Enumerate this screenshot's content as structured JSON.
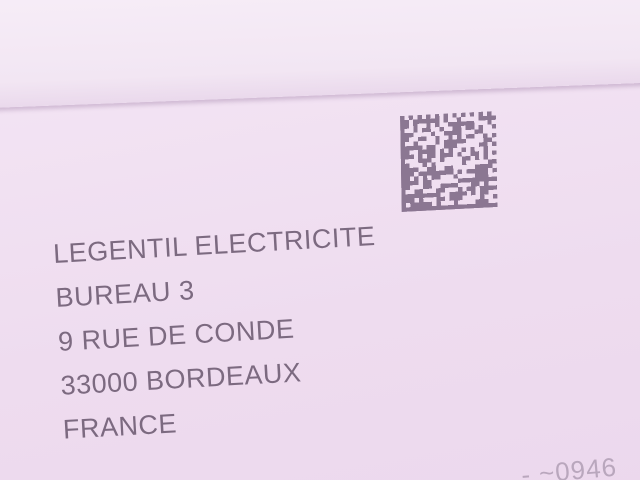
{
  "address": {
    "lines": [
      "LEGENTIL ELECTRICITE",
      "BUREAU 3",
      "9 RUE DE CONDE",
      "33000 BORDEAUX",
      "FRANCE"
    ]
  },
  "colors": {
    "paper": "#efe0f1",
    "ink": "#7c6a80",
    "barcode": "#6f5a78"
  }
}
